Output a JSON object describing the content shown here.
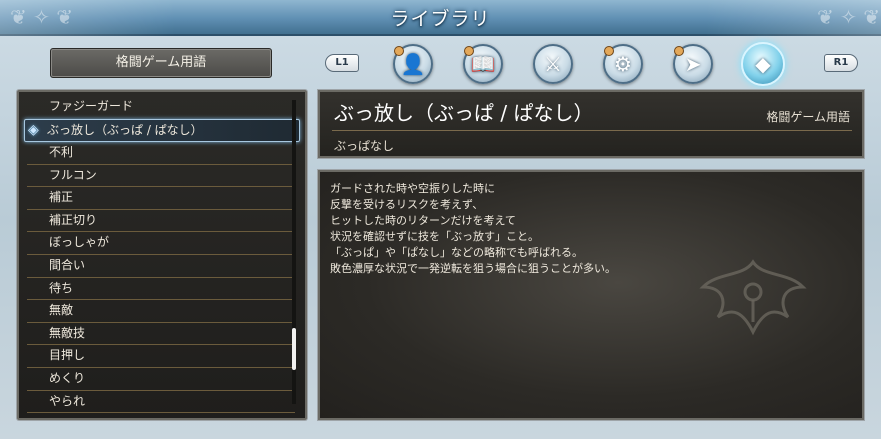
{
  "header": {
    "title": "ライブラリ"
  },
  "category_box": {
    "label": "格闘ゲーム用語"
  },
  "shoulder_buttons": {
    "left": "L1",
    "right": "R1"
  },
  "category_icons": [
    {
      "icon": "character-silhouette-icon",
      "glyph": "👤"
    },
    {
      "icon": "book-icon",
      "glyph": "📖"
    },
    {
      "icon": "sword-icon",
      "glyph": "⚔"
    },
    {
      "icon": "gear-icon",
      "glyph": "⚙"
    },
    {
      "icon": "rider-icon",
      "glyph": "➤"
    },
    {
      "icon": "controller-books-icon",
      "glyph": "◆",
      "active": true
    }
  ],
  "list": {
    "items": [
      "ファジーガード",
      "ぶっ放し（ぶっぱ / ぱなし）",
      "不利",
      "フルコン",
      "補正",
      "補正切り",
      "ぼっしゃが",
      "間合い",
      "待ち",
      "無敵",
      "無敵技",
      "目押し",
      "めくり",
      "やられ"
    ],
    "selected_index": 1,
    "scroll_fraction": 0.75
  },
  "entry": {
    "term": "ぶっ放し（ぶっぱ / ぱなし）",
    "category": "格闘ゲーム用語",
    "reading": "ぶっぱなし",
    "description": [
      "ガードされた時や空振りした時に",
      "反撃を受けるリスクを考えず、",
      "ヒットした時のリターンだけを考えて",
      "状況を確認せずに技を「ぶっ放す」こと。",
      "「ぶっぱ」や「ぱなし」などの略称でも呼ばれる。",
      "敗色濃厚な状況で一発逆転を狙う場合に狙うことが多い。"
    ]
  },
  "colors": {
    "accent": "#7fd0ea",
    "header": "#5f8fb3",
    "panel": "#2b2a27",
    "divider": "#6b5b3c"
  }
}
